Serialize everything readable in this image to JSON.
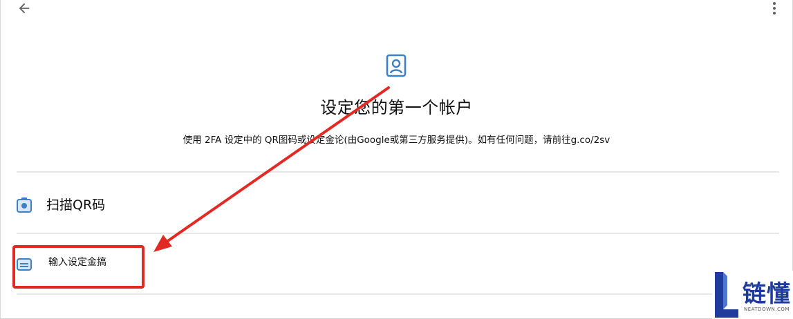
{
  "header": {
    "back_icon": "arrow-left-icon",
    "more_icon": "more-vert-icon"
  },
  "hero": {
    "icon": "account-box-icon",
    "title": "设定您的第一个帐户",
    "description": "使用 2FA 设定中的 QR图码或设定金论(由Google或第三方服务提供)。如有任何问题，请前往g.co/2sv"
  },
  "options": [
    {
      "icon": "camera-icon",
      "label": "扫描QR码"
    },
    {
      "icon": "keyboard-icon",
      "label": "输入设定金搞"
    }
  ],
  "annotation": {
    "highlight_color": "#e22a24"
  },
  "watermark": {
    "brand": "链懂",
    "sub": "NEATDOWN.COM"
  },
  "colors": {
    "icon_blue": "#3f7fc4",
    "divider": "#e6e6e6"
  }
}
